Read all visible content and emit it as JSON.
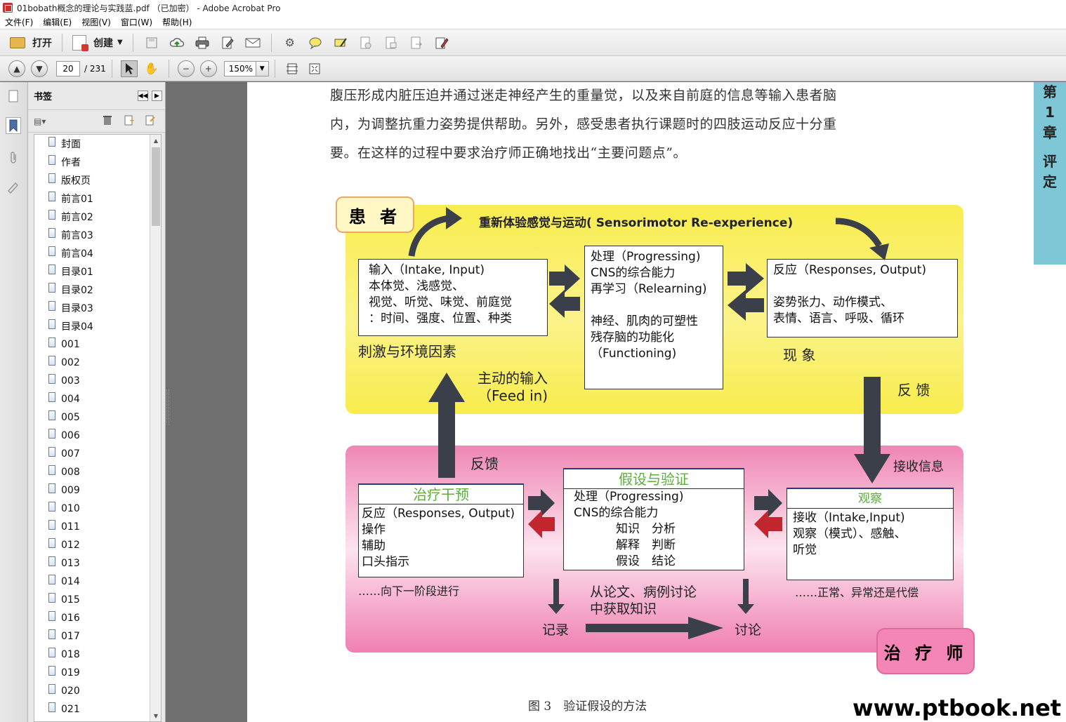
{
  "window": {
    "title": "01bobath概念的理论与实践蓝.pdf （已加密） - Adobe Acrobat Pro"
  },
  "menu": [
    "文件(F)",
    "编辑(E)",
    "视图(V)",
    "窗口(W)",
    "帮助(H)"
  ],
  "toolbar": {
    "open_label": "打开",
    "create_label": "创建"
  },
  "nav": {
    "page_current": "20",
    "page_total": "/ 231",
    "zoom": "150%"
  },
  "bookmarks": {
    "title": "书签",
    "items": [
      "封面",
      "作者",
      "版权页",
      "前言01",
      "前言02",
      "前言03",
      "前言04",
      "目录01",
      "目录02",
      "目录03",
      "目录04",
      "001",
      "002",
      "003",
      "004",
      "005",
      "006",
      "007",
      "008",
      "009",
      "010",
      "011",
      "012",
      "013",
      "014",
      "015",
      "016",
      "017",
      "018",
      "019",
      "020",
      "021"
    ]
  },
  "document": {
    "paragraph": [
      "腹压形成内脏压迫并通过迷走神经产生的重量觉，以及来自前庭的信息等输入患者脑",
      "内，为调整抗重力姿势提供帮助。另外，感受患者执行课题时的四肢运动反应十分重",
      "要。在这样的过程中要求治疗师正确地找出“主要问题点”。"
    ],
    "chapter_tab": [
      "第",
      "1",
      "章",
      "评",
      "定"
    ],
    "caption": "图 3　验证假设的方法",
    "watermark": "www.ptbook.net"
  },
  "diagram": {
    "patient_tag": "患 者",
    "therapist_tag": "治 疗 师",
    "top_title": "重新体验感觉与运动( Sensorimotor Re-experience)",
    "input_box": [
      "输入（Intake, Input)",
      "本体觉、浅感觉、",
      "视觉、听觉、味觉、前庭觉",
      "：时间、强度、位置、种类"
    ],
    "process_box": [
      "处理（Progressing)",
      "CNS的综合能力",
      "再学习（Relearning)",
      "",
      "神经、肌肉的可塑性",
      "残存脑的功能化",
      "（Functioning)"
    ],
    "response_box": [
      "反应（Responses, Output)",
      "",
      "姿势张力、动作模式、",
      "表情、语言、呼吸、循环"
    ],
    "stimulus_label": "刺激与环境因素",
    "phenomenon_label": "现 象",
    "feed_in_label": [
      "主动的输入",
      "（Feed in)"
    ],
    "feedback_right": "反 馈",
    "feedback_left": "反馈",
    "receive_label": "接收信息",
    "treatment_box": {
      "header": "治疗干预",
      "lines": [
        "反应（Responses, Output)",
        "操作",
        "辅助",
        "口头指示"
      ]
    },
    "hypothesis_box": {
      "header": "假设与验证",
      "lines": [
        "处理（Progressing)",
        "CNS的综合能力",
        "知识　分析",
        "解释　判断",
        "假设　结论"
      ]
    },
    "observe_box": {
      "header": "观察",
      "lines": [
        "接收（Intake,Input)",
        "观察（模式）、感触、",
        "听觉"
      ]
    },
    "next_stage": "……向下一阶段进行",
    "normal_label": "……正常、异常还是代偿",
    "knowledge_label": [
      "从论文、病例讨论",
      "中获取知识"
    ],
    "record_label": "记录",
    "discuss_label": "讨论"
  },
  "colors": {
    "yellow": "#f8ed4d",
    "pink": "#ef87b4",
    "arrow_dark": "#3b3f4a",
    "arrow_red": "#c1272d",
    "chapter_tab": "#7dc7d7"
  }
}
